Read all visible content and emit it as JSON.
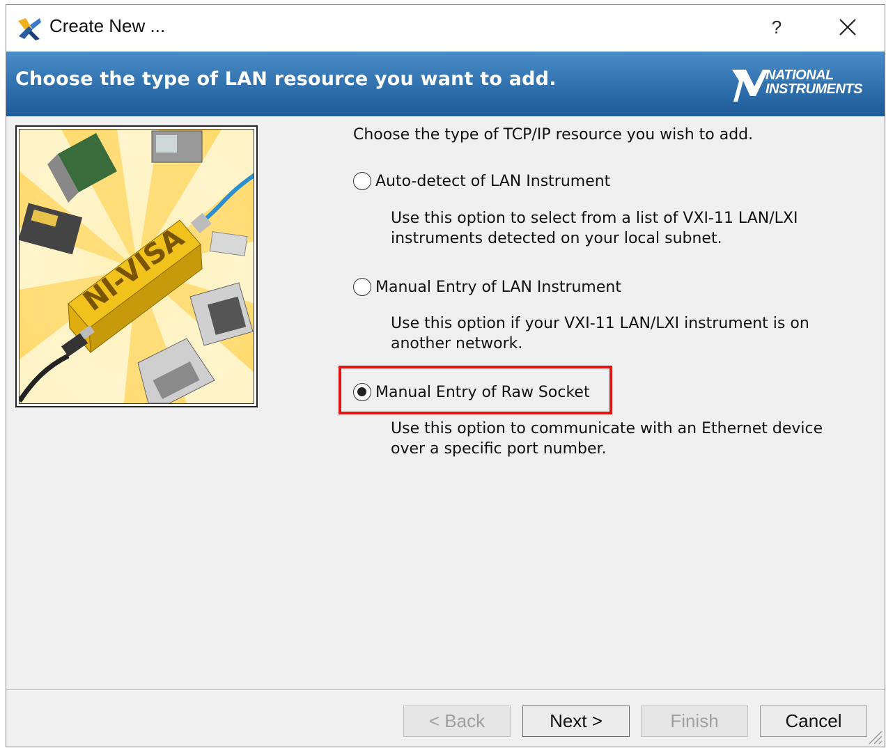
{
  "window": {
    "title": "Create New ...",
    "help_label": "?",
    "close_label": "Close"
  },
  "banner": {
    "heading": "Choose the type of LAN resource you want to add.",
    "logo_line1": "NATIONAL",
    "logo_line2": "INSTRUMENTS"
  },
  "illustration": {
    "product_text": "NI-VISA"
  },
  "content": {
    "intro": "Choose the type of TCP/IP resource you wish to add.",
    "options": [
      {
        "label": "Auto-detect of LAN Instrument",
        "description": "Use this option to select from a list of VXI-11 LAN/LXI instruments detected on your local subnet.",
        "selected": false
      },
      {
        "label": "Manual Entry of LAN Instrument",
        "description": "Use this option if your VXI-11 LAN/LXI instrument is on another network.",
        "selected": false
      },
      {
        "label": "Manual Entry of Raw Socket",
        "description": "Use this option to communicate with an Ethernet device over a specific port number.",
        "selected": true
      }
    ]
  },
  "footer": {
    "back_label": "< Back",
    "next_label": "Next >",
    "finish_label": "Finish",
    "cancel_label": "Cancel"
  },
  "colors": {
    "banner": "#2f70ad",
    "highlight": "#e01616"
  }
}
